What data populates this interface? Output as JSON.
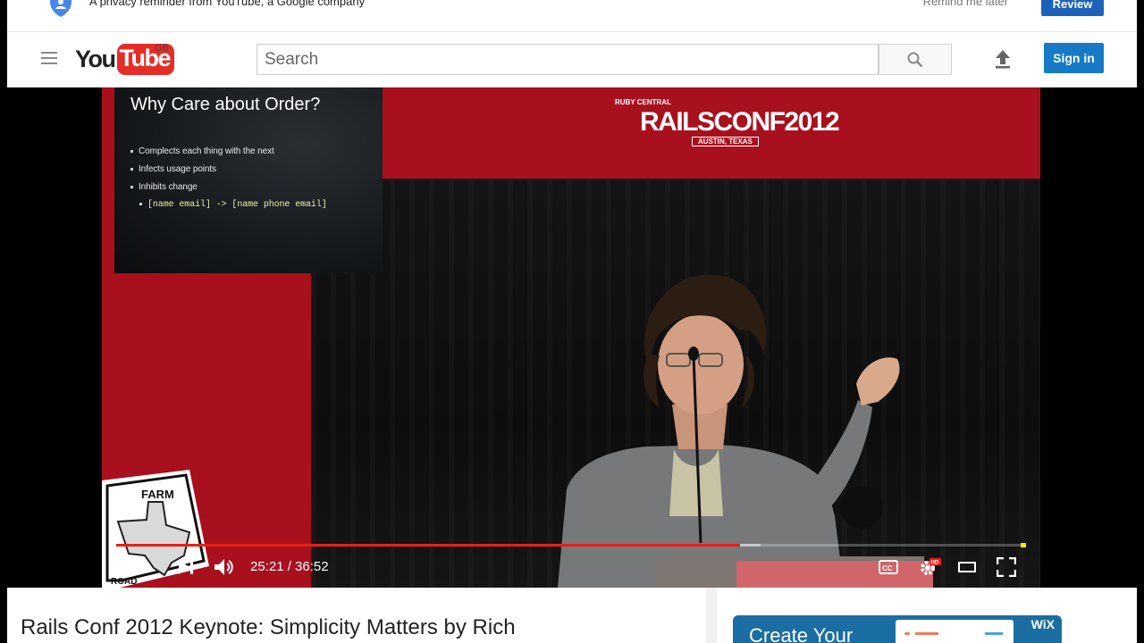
{
  "privacy_banner": {
    "text": "A privacy reminder from YouTube, a Google company",
    "remind_label": "Remind me later",
    "review_label": "Review"
  },
  "header": {
    "logo_you": "You",
    "logo_tube": "Tube",
    "region": "GB",
    "search_placeholder": "Search",
    "sign_in_label": "Sign in"
  },
  "player": {
    "slide": {
      "title": "Why Care about Order?",
      "bullets": [
        "Complects each thing with the next",
        "Infects usage points",
        "Inhibits change"
      ],
      "sub_bullet": "[name email] -> [name phone email]"
    },
    "conference": {
      "presenter": "RUBY CENTRAL",
      "name": "RAILSCONF2012",
      "location": "AUSTIN, TEXAS"
    },
    "overlay_sign": "FARM ROAD",
    "current_time": "25:21",
    "duration": "36:52",
    "time_display": "25:21 / 36:52",
    "played_fraction": 0.687,
    "buffered_fraction": 0.71,
    "hd_badge": "HD",
    "cc_label": "CC"
  },
  "below": {
    "video_title": "Rails Conf 2012 Keynote: Simplicity Matters by Rich",
    "ad_text": "Create Your",
    "ad_brand": "WiX"
  },
  "colors": {
    "youtube_red": "#e52d27",
    "progress_red": "#e62117",
    "signin_blue": "#167ac6",
    "review_blue": "#1c62b9"
  }
}
